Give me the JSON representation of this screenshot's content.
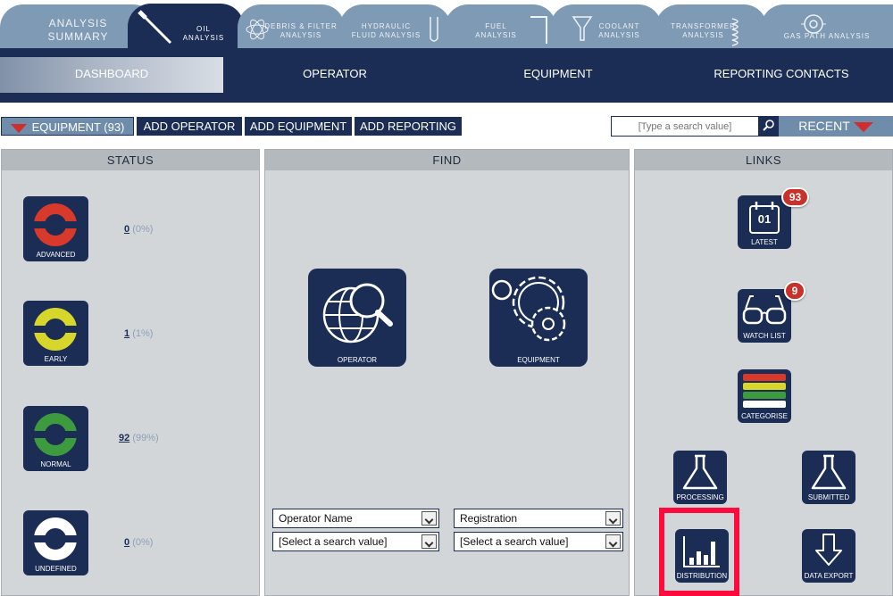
{
  "analysis_tabs": [
    {
      "label_line1": "ANALYSIS",
      "label_line2": "SUMMARY"
    },
    {
      "label_line1": "OIL",
      "label_line2": "ANALYSIS"
    },
    {
      "label_line1": "DEBRIS & FILTER",
      "label_line2": "ANALYSIS"
    },
    {
      "label_line1": "HYDRAULIC",
      "label_line2": "FLUID ANALYSIS"
    },
    {
      "label_line1": "FUEL",
      "label_line2": "ANALYSIS"
    },
    {
      "label_line1": "COOLANT",
      "label_line2": "ANALYSIS"
    },
    {
      "label_line1": "TRANSFORMER",
      "label_line2": "ANALYSIS"
    },
    {
      "label_line1": "GAS PATH ANALYSIS",
      "label_line2": ""
    }
  ],
  "nav": {
    "dashboard": "DASHBOARD",
    "operator": "OPERATOR",
    "equipment": "EQUIPMENT",
    "reporting_contacts": "REPORTING CONTACTS"
  },
  "actions": {
    "equipment": "EQUIPMENT (93)",
    "add_operator": "ADD OPERATOR",
    "add_equipment": "ADD EQUIPMENT",
    "add_reporting": "ADD REPORTING",
    "search_placeholder": "[Type a search value]",
    "recent": "RECENT"
  },
  "status": {
    "title": "STATUS",
    "items": [
      {
        "label": "ADVANCED",
        "count": "0",
        "pct": "(0%)",
        "color": "#d73a2b"
      },
      {
        "label": "EARLY",
        "count": "1",
        "pct": "(1%)",
        "color": "#d7d62a"
      },
      {
        "label": "NORMAL",
        "count": "92",
        "pct": "(99%)",
        "color": "#3e9a3e"
      },
      {
        "label": "UNDEFINED",
        "count": "0",
        "pct": "(0%)",
        "color": "#ffffff"
      }
    ]
  },
  "find": {
    "title": "FIND",
    "operator": "OPERATOR",
    "equipment": "EQUIPMENT",
    "field1": "Operator Name",
    "field2": "Registration",
    "value1": "[Select a search value]",
    "value2": "[Select a search value]"
  },
  "links": {
    "title": "LINKS",
    "latest": "LATEST",
    "latest_day": "01",
    "latest_badge": "93",
    "watch_list": "WATCH LIST",
    "watch_badge": "9",
    "categorise": "CATEGORISE",
    "processing": "PROCESSING",
    "submitted": "SUBMITTED",
    "distribution": "DISTRIBUTION",
    "data_export": "DATA EXPORT"
  },
  "colors": {
    "navy": "#1b2c55",
    "steel": "#7f9ab5",
    "highlight": "#ff0a3c",
    "badge": "#c9322b"
  }
}
